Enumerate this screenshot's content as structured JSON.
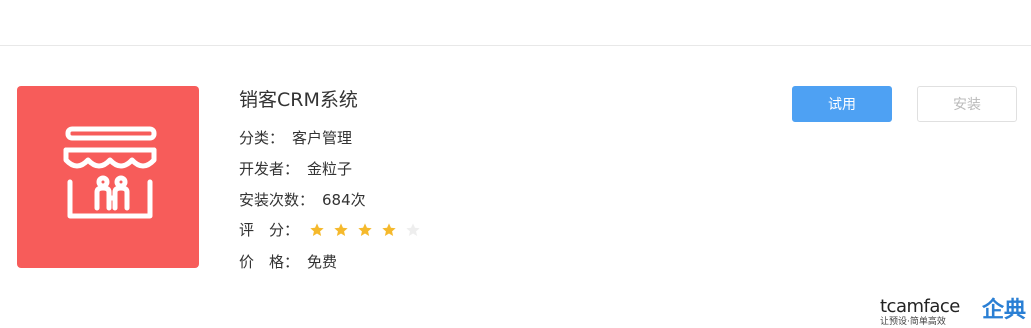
{
  "app": {
    "title": "销客CRM系统",
    "icon": "storefront-icon",
    "icon_bg": "#f75c5a",
    "category_label": "分类：",
    "category_value": "客户管理",
    "developer_label": "开发者：",
    "developer_value": "金粒子",
    "installs_label": "安装次数：",
    "installs_value": "684次",
    "rating_label": "评　分：",
    "rating_value": 4,
    "rating_max": 5,
    "price_label": "价　格：",
    "price_value": "免费"
  },
  "actions": {
    "trial_label": "试用",
    "install_label": "安装"
  },
  "watermark": {
    "brand": "tcamface",
    "slogan": "让预设·简单高效",
    "cn": "企典"
  },
  "colors": {
    "accent": "#4ea1f3",
    "star_filled": "#f5b92c",
    "star_empty": "#eeeeee"
  }
}
